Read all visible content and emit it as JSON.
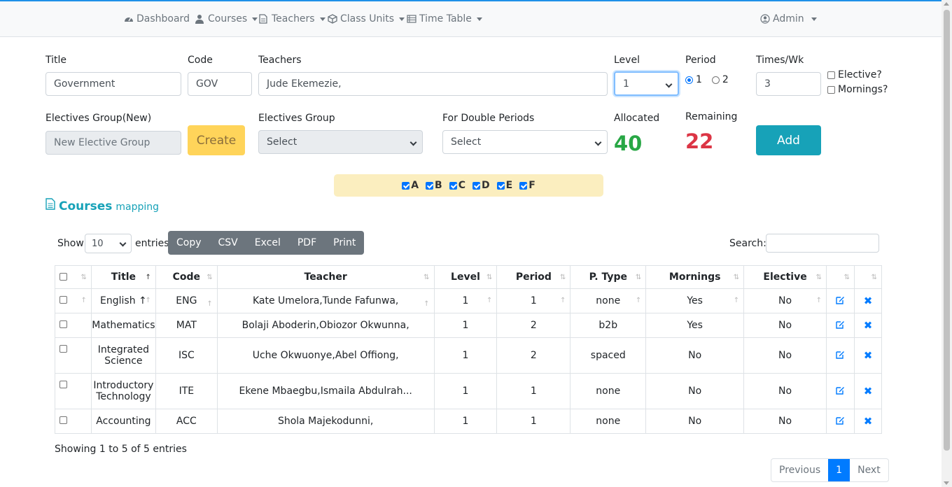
{
  "nav": {
    "dashboard": "Dashboard",
    "courses": "Courses",
    "teachers": "Teachers",
    "class_units": "Class Units",
    "time_table": "Time Table",
    "admin": "Admin"
  },
  "form": {
    "title_label": "Title",
    "title_value": "Government",
    "code_label": "Code",
    "code_value": "GOV",
    "teachers_label": "Teachers",
    "teachers_value": "Jude Ekemezie,",
    "level_label": "Level",
    "level_value": "1",
    "period_label": "Period",
    "period_opt1": "1",
    "period_opt2": "2",
    "times_label": "Times/Wk",
    "times_value": "3",
    "elective_label": "Elective?",
    "mornings_label": "Mornings?",
    "electives_new_label": "Electives Group(New)",
    "electives_new_placeholder": "New Elective Group",
    "create_label": "Create",
    "electives_group_label": "Electives Group",
    "electives_group_value": "Select",
    "double_periods_label": "For Double Periods",
    "double_periods_value": "Select",
    "allocated_label": "Allocated",
    "allocated_value": "40",
    "remaining_label": "Remaining",
    "remaining_value": "22",
    "add_label": "Add"
  },
  "units": [
    "A",
    "B",
    "C",
    "D",
    "E",
    "F"
  ],
  "section": {
    "title": "Courses",
    "subtitle": "mapping"
  },
  "table_controls": {
    "show": "Show",
    "entries_value": "10",
    "entries": "entries",
    "buttons": [
      "Copy",
      "CSV",
      "Excel",
      "PDF",
      "Print"
    ],
    "search": "Search:"
  },
  "table": {
    "headers": [
      "Title",
      "Code",
      "Teacher",
      "Level",
      "Period",
      "P. Type",
      "Mornings",
      "Elective"
    ],
    "rows": [
      [
        "English ↑",
        "ENG",
        "Kate Umelora,Tunde Fafunwa,",
        "1",
        "1",
        "none",
        "Yes",
        "No"
      ],
      [
        "Mathematics",
        "MAT",
        "Bolaji Aboderin,Obiozor Okwunna,",
        "1",
        "2",
        "b2b",
        "Yes",
        "No"
      ],
      [
        "Integrated Science",
        "ISC",
        "Uche Okwuonye,Abel Offiong,",
        "1",
        "2",
        "spaced",
        "No",
        "No"
      ],
      [
        "Introductory Technology",
        "ITE",
        "Ekene Mbaegbu,Ismaila Abdulrah...",
        "1",
        "1",
        "none",
        "No",
        "No"
      ],
      [
        "Accounting",
        "ACC",
        "Shola Majekodunni,",
        "1",
        "1",
        "none",
        "No",
        "No"
      ]
    ]
  },
  "footer": {
    "info": "Showing 1 to 5 of 5 entries",
    "previous": "Previous",
    "page": "1",
    "next": "Next"
  },
  "icons": {
    "dashboard": "tachometer-icon",
    "courses": "user-icon",
    "teachers": "file-icon",
    "class_units": "cube-icon",
    "time_table": "list-icon",
    "admin": "user-circle-icon",
    "edit": "edit-icon",
    "delete": "close-icon"
  },
  "colors": {
    "accent": "#17a2b8",
    "allocated": "#28a745",
    "remaining": "#dc3545",
    "primary": "#007bff",
    "warning": "#ffd45a"
  }
}
